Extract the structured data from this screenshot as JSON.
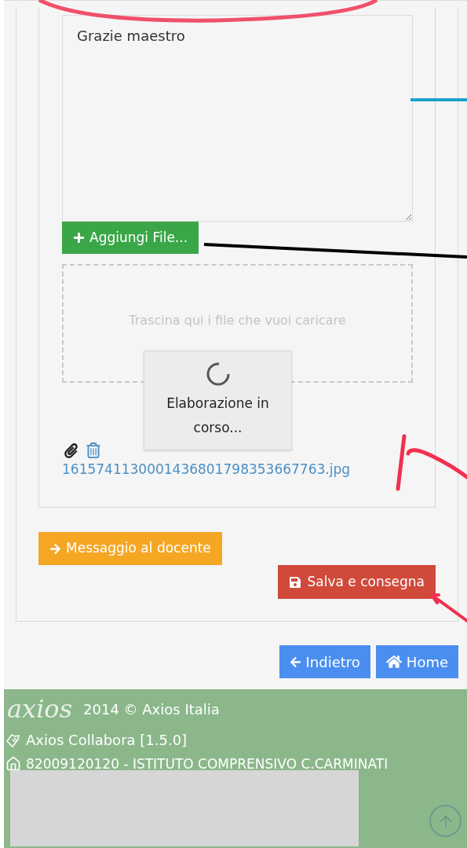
{
  "message": {
    "value": "Grazie maestro"
  },
  "add_file_button": {
    "label": "Aggiungi File..."
  },
  "dropzone": {
    "placeholder": "Trascina qui i file che vuoi caricare"
  },
  "processing_dialog": {
    "text": "Elaborazione in corso..."
  },
  "attachment": {
    "filename": "1615741130001436801798353667763.jpg"
  },
  "message_button": {
    "label": "Messaggio al docente"
  },
  "save_button": {
    "label": "Salva e consegna"
  },
  "nav_buttons": [
    {
      "kind": "back",
      "label": "Indietro"
    },
    {
      "kind": "home",
      "label": "Home"
    }
  ],
  "footer": {
    "logo": "axios",
    "copyright": "2014 © Axios Italia",
    "app_version": "Axios Collabora [1.5.0]",
    "school": "82009120120 - ISTITUTO COMPRENSIVO C.CARMINATI"
  }
}
